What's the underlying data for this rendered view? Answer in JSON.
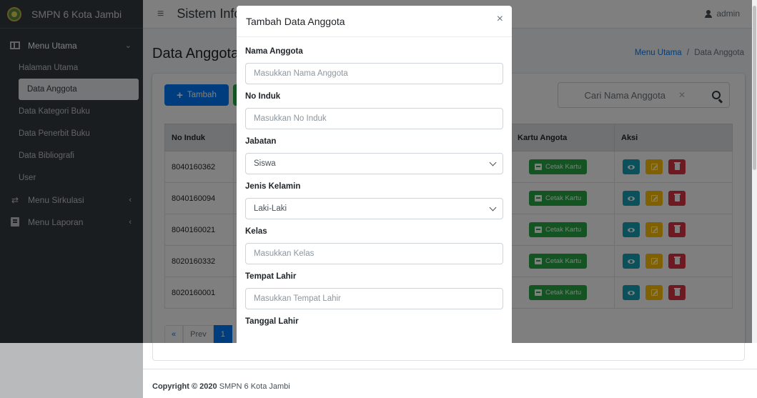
{
  "brand": {
    "name": "SMPN 6 Kota Jambi"
  },
  "navbar": {
    "title": "Sistem Informasi Perpustakaan",
    "user": "admin"
  },
  "sidebar": {
    "items": [
      {
        "label": "Menu Utama"
      },
      {
        "label": "Menu Sirkulasi"
      },
      {
        "label": "Menu Laporan"
      }
    ],
    "submenu": [
      {
        "label": "Halaman Utama"
      },
      {
        "label": "Data Anggota"
      },
      {
        "label": "Data Kategori Buku"
      },
      {
        "label": "Data Penerbit Buku"
      },
      {
        "label": "Data Bibliografi"
      },
      {
        "label": "User"
      }
    ]
  },
  "page": {
    "title": "Data Anggota",
    "breadcrumb": {
      "home": "Menu Utama",
      "separator": "/",
      "current": "Data Anggota"
    }
  },
  "toolbar": {
    "add_label": "Tambah",
    "search_placeholder": "Cari Nama Anggota"
  },
  "table": {
    "headers": {
      "no_induk": "No Induk",
      "kartu": "Kartu Angota",
      "aksi": "Aksi"
    },
    "print_label": "Cetak Kartu",
    "rows": [
      {
        "no_induk": "8040160362"
      },
      {
        "no_induk": "8040160094"
      },
      {
        "no_induk": "8040160021"
      },
      {
        "no_induk": "8020160332"
      },
      {
        "no_induk": "8020160001"
      }
    ]
  },
  "pagination": {
    "first": "«",
    "prev": "Prev",
    "current": "1"
  },
  "footer": {
    "copyright_bold": "Copyright © 2020",
    "owner": "SMPN 6 Kota Jambi"
  },
  "modal": {
    "title": "Tambah Data Anggota",
    "close": "×",
    "fields": {
      "nama": {
        "label": "Nama Anggota",
        "placeholder": "Masukkan Nama Anggota"
      },
      "no_induk": {
        "label": "No Induk",
        "placeholder": "Masukkan No Induk"
      },
      "jabatan": {
        "label": "Jabatan",
        "value": "Siswa"
      },
      "jenis_kelamin": {
        "label": "Jenis Kelamin",
        "value": "Laki-Laki"
      },
      "kelas": {
        "label": "Kelas",
        "placeholder": "Masukkan Kelas"
      },
      "tempat_lahir": {
        "label": "Tempat Lahir",
        "placeholder": "Masukkan Tempat Lahir"
      },
      "tanggal_lahir": {
        "label": "Tanggal Lahir"
      }
    }
  },
  "colors": {
    "sidebar_bg": "#343a40",
    "primary": "#007bff",
    "success": "#28a745",
    "info": "#17a2b8",
    "warning": "#ffc107",
    "danger": "#dc3545"
  }
}
